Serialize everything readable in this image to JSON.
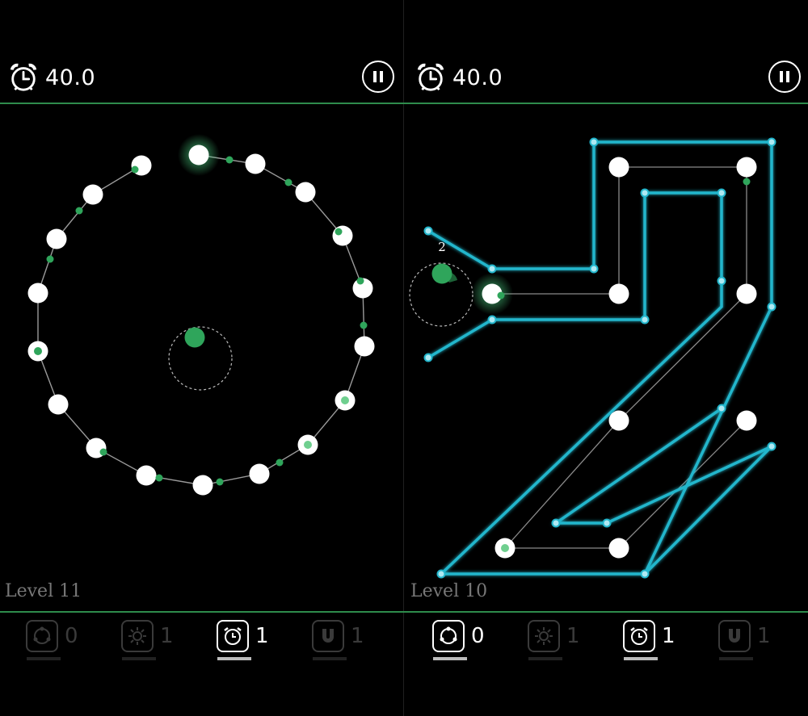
{
  "left_panel": {
    "timer": "40.0",
    "level_label": "Level 11",
    "powerups": [
      {
        "name": "rotate-icon",
        "count": "0",
        "state": "dim"
      },
      {
        "name": "sun-icon",
        "count": "1",
        "state": "dim"
      },
      {
        "name": "alarm-clock-icon",
        "count": "1",
        "state": "active"
      },
      {
        "name": "magnet-icon",
        "count": "1",
        "state": "dim"
      }
    ]
  },
  "right_panel": {
    "timer": "40.0",
    "level_label": "Level 10",
    "move_counter": "2",
    "powerups": [
      {
        "name": "rotate-icon",
        "count": "0",
        "state": "active"
      },
      {
        "name": "sun-icon",
        "count": "1",
        "state": "dim"
      },
      {
        "name": "alarm-clock-icon",
        "count": "1",
        "state": "active"
      },
      {
        "name": "magnet-icon",
        "count": "1",
        "state": "dim"
      }
    ]
  },
  "colors": {
    "accent_green": "#2fa55b",
    "divider_green": "#2e8c4c",
    "path_cyan": "#22b6cc",
    "node_white": "#ffffff",
    "background": "#000000"
  }
}
